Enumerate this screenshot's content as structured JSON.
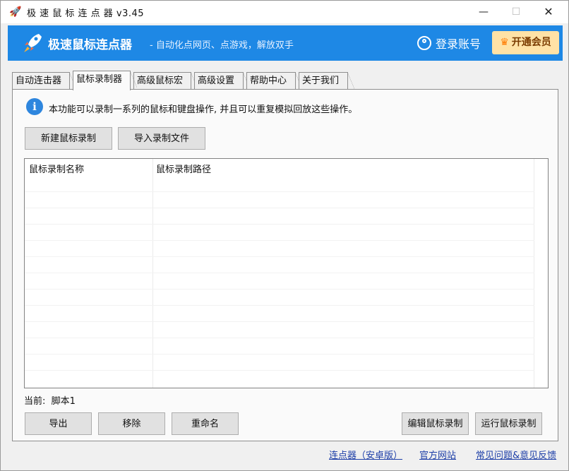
{
  "window": {
    "title": "极 速 鼠 标 连 点 器 v3.45"
  },
  "banner": {
    "brand": "极速鼠标连点器",
    "slogan": "- 自动化点网页、点游戏，解放双手",
    "login": "登录账号",
    "vip": "开通会员"
  },
  "tabs": [
    "自动连击器",
    "鼠标录制器",
    "高级鼠标宏",
    "高级设置",
    "帮助中心",
    "关于我们"
  ],
  "panel": {
    "info": "本功能可以录制一系列的鼠标和键盘操作, 并且可以重复模拟回放这些操作。",
    "new_button": "新建鼠标录制",
    "import_button": "导入录制文件",
    "columns": [
      "鼠标录制名称",
      "鼠标录制路径"
    ],
    "current_label": "当前:",
    "current_value": "脚本1",
    "export_button": "导出",
    "remove_button": "移除",
    "rename_button": "重命名",
    "edit_button": "编辑鼠标录制",
    "run_button": "运行鼠标录制"
  },
  "footer": {
    "android": "连点器（安卓版）",
    "website": "官方网站",
    "faq": "常见问题&意见反馈"
  },
  "colors": {
    "banner": "#1e88e5",
    "vip_bg": "#ffe2a6",
    "link": "#1e3fa8"
  }
}
